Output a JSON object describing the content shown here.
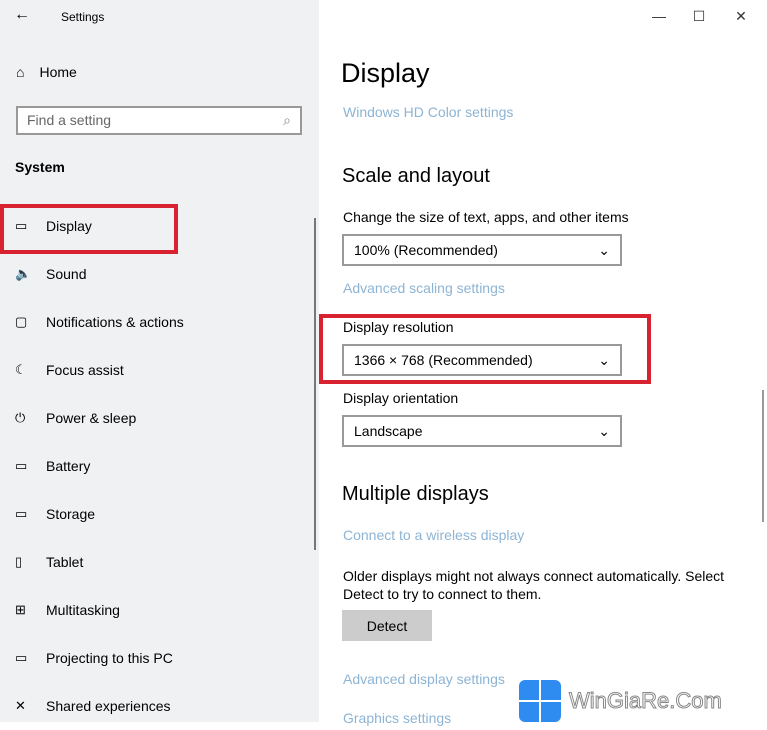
{
  "window": {
    "title": "Settings",
    "minimize": "—",
    "maximize": "☐",
    "close": "✕",
    "back": "←"
  },
  "sidebar": {
    "home": "Home",
    "search_placeholder": "Find a setting",
    "section": "System",
    "items": [
      {
        "label": "Display",
        "icon": "monitor-icon",
        "glyph": "▭"
      },
      {
        "label": "Sound",
        "icon": "speaker-icon",
        "glyph": "🔈"
      },
      {
        "label": "Notifications & actions",
        "icon": "notification-icon",
        "glyph": "▢"
      },
      {
        "label": "Focus assist",
        "icon": "moon-icon",
        "glyph": "☾"
      },
      {
        "label": "Power & sleep",
        "icon": "power-icon",
        "glyph": "⏻"
      },
      {
        "label": "Battery",
        "icon": "battery-icon",
        "glyph": "▭"
      },
      {
        "label": "Storage",
        "icon": "storage-icon",
        "glyph": "▭"
      },
      {
        "label": "Tablet",
        "icon": "tablet-icon",
        "glyph": "▯"
      },
      {
        "label": "Multitasking",
        "icon": "multitasking-icon",
        "glyph": "⊞"
      },
      {
        "label": "Projecting to this PC",
        "icon": "projecting-icon",
        "glyph": "▭"
      },
      {
        "label": "Shared experiences",
        "icon": "shared-icon",
        "glyph": "✕"
      }
    ]
  },
  "main": {
    "title": "Display",
    "hd_link": "Windows HD Color settings",
    "scale_heading": "Scale and layout",
    "scale_label": "Change the size of text, apps, and other items",
    "scale_value": "100% (Recommended)",
    "adv_scaling": "Advanced scaling settings",
    "res_label": "Display resolution",
    "res_value": "1366 × 768 (Recommended)",
    "orient_label": "Display orientation",
    "orient_value": "Landscape",
    "multi_heading": "Multiple displays",
    "wireless_link": "Connect to a wireless display",
    "older_text": "Older displays might not always connect automatically. Select Detect to try to connect to them.",
    "detect": "Detect",
    "adv_display": "Advanced display settings",
    "graphics": "Graphics settings"
  },
  "watermark": "WinGiaRe.Com",
  "colors": {
    "highlight": "#d8222f",
    "link": "#8db4d4"
  }
}
